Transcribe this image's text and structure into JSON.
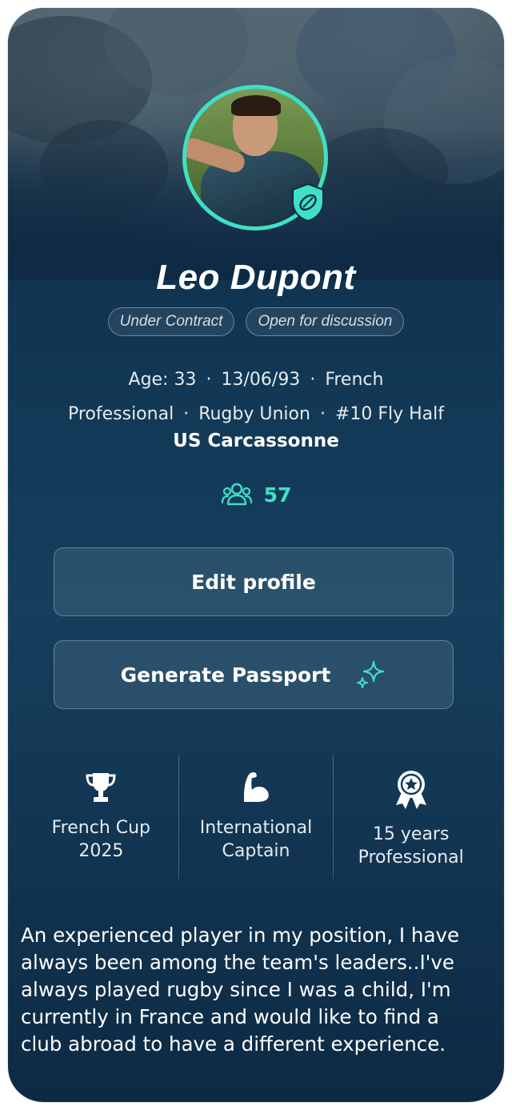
{
  "profile": {
    "name": "Leo Dupont",
    "tags": [
      "Under Contract",
      "Open for discussion"
    ],
    "age": "Age: 33",
    "birthdate": "13/06/93",
    "nationality": "French",
    "level": "Professional",
    "sport": "Rugby Union",
    "position": "#10 Fly Half",
    "club": "US Carcassonne",
    "followers": "57",
    "avatar_badge_icon": "rugby-ball-shield-icon"
  },
  "actions": {
    "edit_label": "Edit profile",
    "passport_label": "Generate Passport",
    "passport_icon": "sparkles-icon"
  },
  "stats": [
    {
      "icon": "trophy-icon",
      "label": "French Cup\n2025"
    },
    {
      "icon": "flexed-bicep-icon",
      "label": "International\nCaptain"
    },
    {
      "icon": "award-medal-icon",
      "label": "15 years\nProfessional"
    }
  ],
  "bio": "An experienced player in my position, I have always been among the team's leaders..I've always played rugby since I was a child, I'm currently in France and would like to find a club abroad to have a different experience.",
  "colors": {
    "accent": "#3fe0c5",
    "background": "#123a58",
    "text": "#ffffff"
  }
}
